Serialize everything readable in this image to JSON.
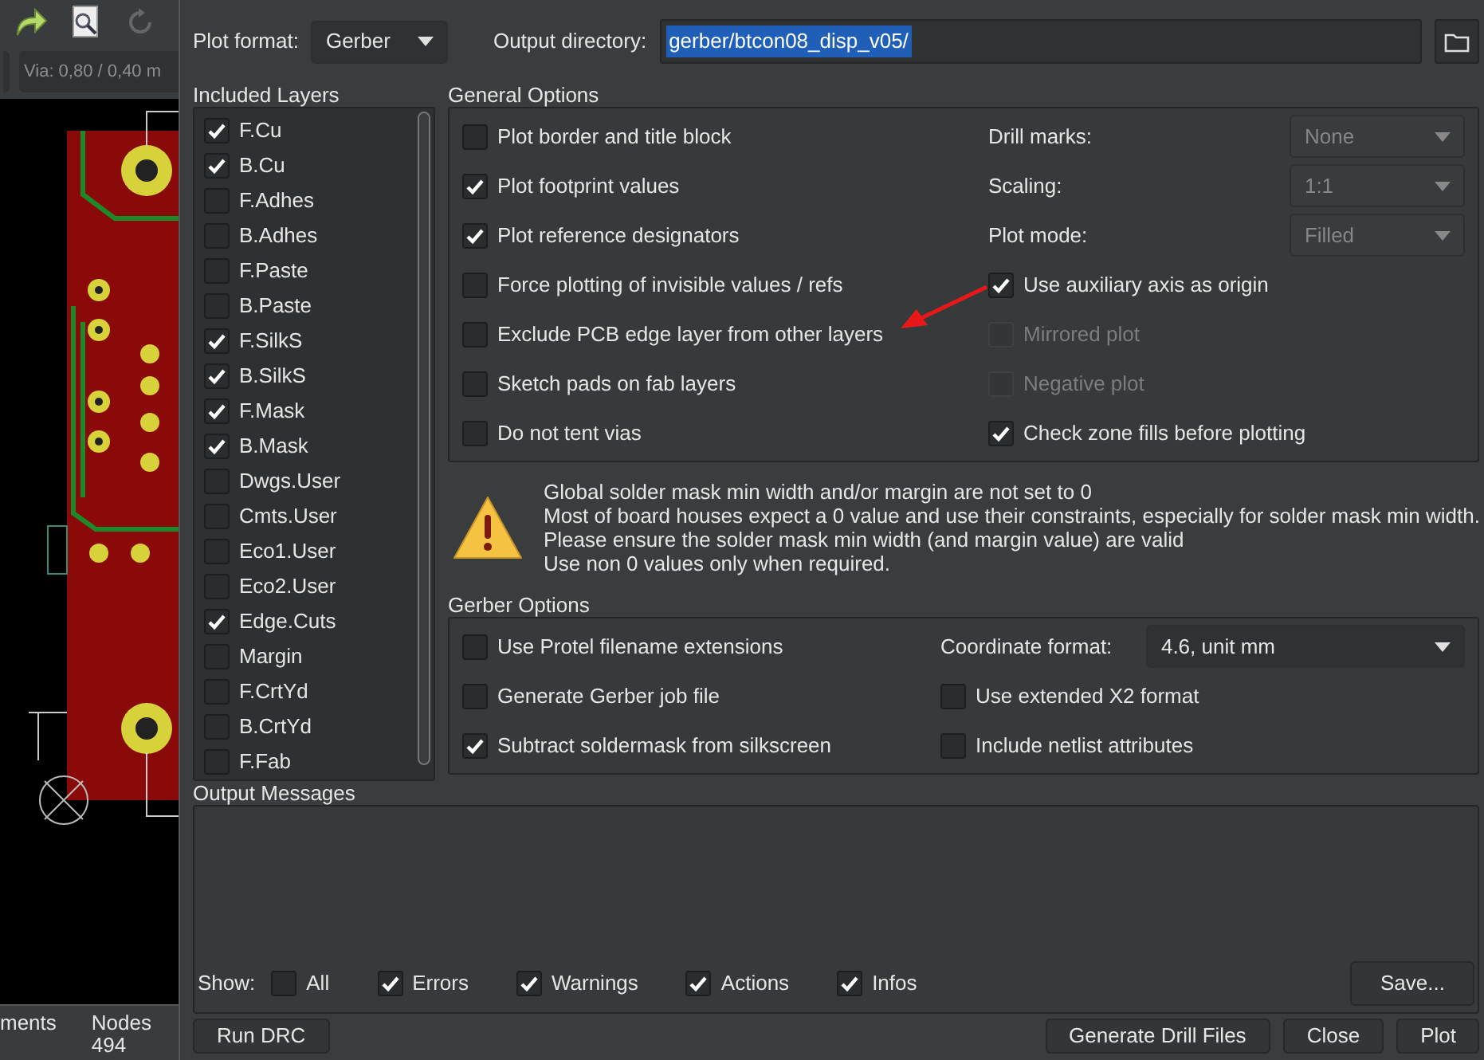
{
  "toolbar": {
    "via_field": "Via: 0,80 / 0,40 m"
  },
  "status_bar": {
    "column_1": "ments",
    "nodes_label": "Nodes",
    "nodes_value": "494"
  },
  "plot_format": {
    "label": "Plot format:",
    "value": "Gerber"
  },
  "output_directory": {
    "label": "Output directory:",
    "value": "gerber/btcon08_disp_v05/"
  },
  "included_layers": {
    "title": "Included Layers",
    "layers": [
      {
        "name": "F.Cu",
        "checked": true
      },
      {
        "name": "B.Cu",
        "checked": true
      },
      {
        "name": "F.Adhes",
        "checked": false
      },
      {
        "name": "B.Adhes",
        "checked": false
      },
      {
        "name": "F.Paste",
        "checked": false
      },
      {
        "name": "B.Paste",
        "checked": false
      },
      {
        "name": "F.SilkS",
        "checked": true
      },
      {
        "name": "B.SilkS",
        "checked": true
      },
      {
        "name": "F.Mask",
        "checked": true
      },
      {
        "name": "B.Mask",
        "checked": true
      },
      {
        "name": "Dwgs.User",
        "checked": false
      },
      {
        "name": "Cmts.User",
        "checked": false
      },
      {
        "name": "Eco1.User",
        "checked": false
      },
      {
        "name": "Eco2.User",
        "checked": false
      },
      {
        "name": "Edge.Cuts",
        "checked": true
      },
      {
        "name": "Margin",
        "checked": false
      },
      {
        "name": "F.CrtYd",
        "checked": false
      },
      {
        "name": "B.CrtYd",
        "checked": false
      },
      {
        "name": "F.Fab",
        "checked": false
      }
    ]
  },
  "general_options": {
    "title": "General Options",
    "left": [
      {
        "label": "Plot border and title block",
        "checked": false
      },
      {
        "label": "Plot footprint values",
        "checked": true
      },
      {
        "label": "Plot reference designators",
        "checked": true
      },
      {
        "label": "Force plotting of invisible values / refs",
        "checked": false
      },
      {
        "label": "Exclude PCB edge layer from other layers",
        "checked": false
      },
      {
        "label": "Sketch pads on fab layers",
        "checked": false
      },
      {
        "label": "Do not tent vias",
        "checked": false
      }
    ],
    "right": [
      {
        "kind": "dropdown",
        "label": "Drill marks:",
        "value": "None",
        "disabled": true
      },
      {
        "kind": "dropdown",
        "label": "Scaling:",
        "value": "1:1",
        "disabled": true
      },
      {
        "kind": "dropdown",
        "label": "Plot mode:",
        "value": "Filled",
        "disabled": true
      },
      {
        "kind": "checkbox",
        "label": "Use auxiliary axis as origin",
        "checked": true,
        "disabled": false
      },
      {
        "kind": "checkbox",
        "label": "Mirrored plot",
        "checked": false,
        "disabled": true
      },
      {
        "kind": "checkbox",
        "label": "Negative plot",
        "checked": false,
        "disabled": true
      },
      {
        "kind": "checkbox",
        "label": "Check zone fills before plotting",
        "checked": true,
        "disabled": false
      }
    ]
  },
  "warning": {
    "lines": [
      "Global solder mask min width and/or margin are not set to 0",
      "Most of board houses expect a 0 value and use their constraints, especially for solder mask min width.",
      "Please ensure the  solder mask min width (and margin value) are valid",
      "Use non 0 values only when required."
    ]
  },
  "gerber_options": {
    "title": "Gerber Options",
    "left": [
      {
        "label": "Use Protel filename extensions",
        "checked": false
      },
      {
        "label": "Generate Gerber job file",
        "checked": false
      },
      {
        "label": "Subtract soldermask from silkscreen",
        "checked": true
      }
    ],
    "right": [
      {
        "kind": "dropdown",
        "label": "Coordinate format:",
        "value": "4.6, unit mm",
        "disabled": false
      },
      {
        "kind": "checkbox",
        "label": "Use extended X2 format",
        "checked": false,
        "disabled": false
      },
      {
        "kind": "checkbox",
        "label": "Include netlist attributes",
        "checked": false,
        "disabled": false
      }
    ]
  },
  "output_messages": {
    "title": "Output Messages",
    "show_label": "Show:",
    "filters": [
      {
        "label": "All",
        "checked": false
      },
      {
        "label": "Errors",
        "checked": true
      },
      {
        "label": "Warnings",
        "checked": true
      },
      {
        "label": "Actions",
        "checked": true
      },
      {
        "label": "Infos",
        "checked": true
      }
    ],
    "save_button": "Save..."
  },
  "buttons": [
    "Run DRC",
    "Generate Drill Files",
    "Close",
    "Plot"
  ]
}
